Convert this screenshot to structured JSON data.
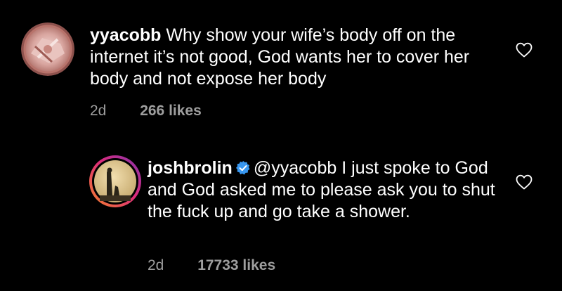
{
  "comments": [
    {
      "username": "yyacobb",
      "text": " Why show your wife’s body off on the internet it’s not good, God wants her to cover her body and not expose her body",
      "time": "2d",
      "likes": "266 likes",
      "verified": false,
      "avatar_icon": "profile-photo-icon",
      "like_icon": "heart-outline-icon"
    },
    {
      "username": "joshbrolin",
      "mention": "@yyacobb",
      "text": " I just spoke to God and God asked me to please ask you to shut the fuck up and go take a shower.",
      "time": "2d",
      "likes": "17733 likes",
      "verified": true,
      "verified_icon": "verified-badge-icon",
      "avatar_icon": "profile-photo-icon",
      "like_icon": "heart-outline-icon"
    }
  ],
  "colors": {
    "background": "#000000",
    "text": "#ffffff",
    "meta": "#9e9e9e",
    "verified": "#3897f0",
    "story_ring_start": "#f58529",
    "story_ring_end": "#dd2a7b"
  }
}
